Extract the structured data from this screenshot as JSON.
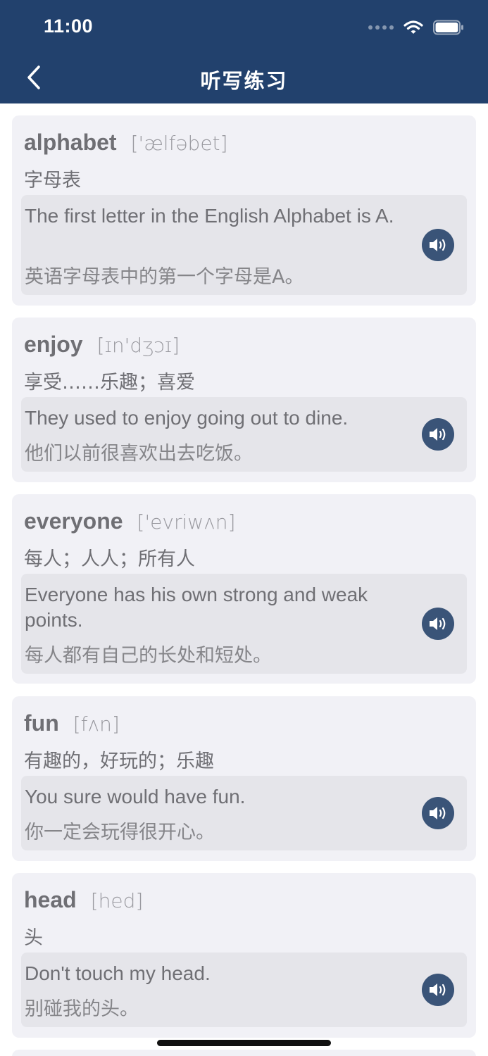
{
  "status_bar": {
    "time": "11:00"
  },
  "nav": {
    "title": "听写练习"
  },
  "words": [
    {
      "word": "alphabet",
      "phonetic": "['ælfəbet]",
      "meaning": "字母表",
      "example_en": "The first letter in the English Alphabet is A.",
      "example_zh": "英语字母表中的第一个字母是A。"
    },
    {
      "word": "enjoy",
      "phonetic": "[ɪn'dʒɔɪ]",
      "meaning": "享受……乐趣；喜爱",
      "example_en": "They used to enjoy going out to dine.",
      "example_zh": "他们以前很喜欢出去吃饭。"
    },
    {
      "word": "everyone",
      "phonetic": "['evriwʌn]",
      "meaning": "每人；人人；所有人",
      "example_en": "Everyone has his own strong and weak points.",
      "example_zh": "每人都有自己的长处和短处。"
    },
    {
      "word": "fun",
      "phonetic": "[fʌn]",
      "meaning": "有趣的，好玩的；乐趣",
      "example_en": "You sure would have fun.",
      "example_zh": "你一定会玩得很开心。"
    },
    {
      "word": "head",
      "phonetic": "[hed]",
      "meaning": "头",
      "example_en": "Don't touch my head.",
      "example_zh": "别碰我的头。"
    }
  ],
  "colors": {
    "header": "#22416d",
    "card": "#f1f1f6",
    "example": "#e5e5ea",
    "speaker": "#3a5478"
  },
  "icons": {
    "back": "chevron-left-icon",
    "speaker": "speaker-icon",
    "wifi": "wifi-icon",
    "battery": "battery-icon"
  }
}
